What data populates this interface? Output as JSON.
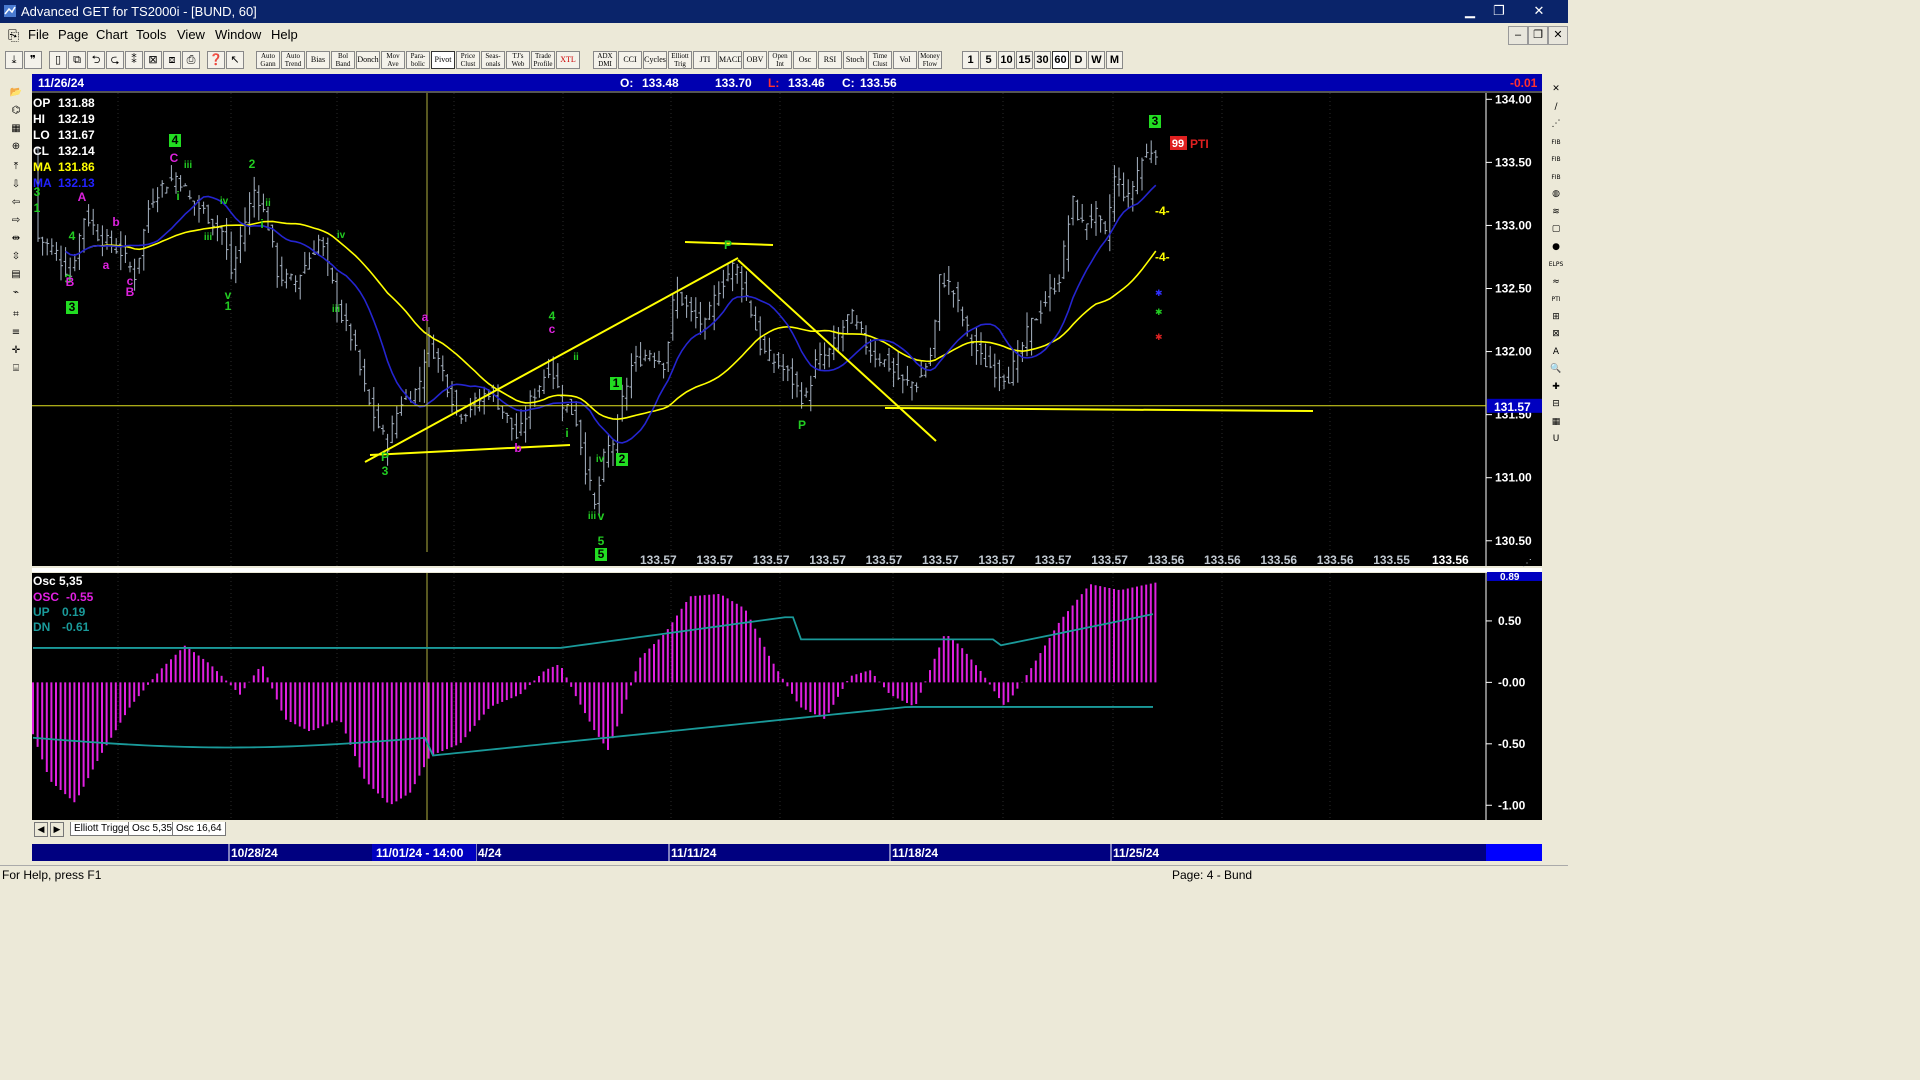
{
  "window": {
    "title": "Advanced GET for TS2000i - [BUND, 60]",
    "min": "▁",
    "restore": "❐",
    "close": "✕"
  },
  "menu": [
    "File",
    "Page",
    "Chart",
    "Tools",
    "View",
    "Window",
    "Help"
  ],
  "mdi_buttons": [
    "‒",
    "❐",
    "✕"
  ],
  "toolbar_icons": [
    "⤓",
    "❞",
    "▯",
    "⧉",
    "⮌",
    "⮎",
    "⁑",
    "⊠",
    "⧈",
    "⎙",
    "❓",
    "↖"
  ],
  "toolbar_studies": [
    [
      "Auto",
      "Gann"
    ],
    [
      "Auto",
      "Trend"
    ],
    [
      "Bias",
      ""
    ],
    [
      "Bol",
      "Band"
    ],
    [
      "Donch",
      ""
    ],
    [
      "Mov",
      "Ave"
    ],
    [
      "Para-",
      "bolic"
    ],
    [
      "Pivot",
      ""
    ],
    [
      "Price",
      "Clust"
    ],
    [
      "Seas-",
      "onals"
    ],
    [
      "TJ's",
      "Web"
    ],
    [
      "Trade",
      "Profile"
    ],
    [
      "XTL",
      ""
    ],
    [
      "ADX",
      "DMI"
    ],
    [
      "CCI",
      ""
    ],
    [
      "Cycles",
      ""
    ],
    [
      "Elliott",
      "Trig"
    ],
    [
      "JTI",
      ""
    ],
    [
      "MACD",
      ""
    ],
    [
      "OBV",
      ""
    ],
    [
      "Open",
      "Int"
    ],
    [
      "Osc",
      ""
    ],
    [
      "RSI",
      ""
    ],
    [
      "Stoch",
      ""
    ],
    [
      "Time",
      "Clust"
    ],
    [
      "Vol",
      ""
    ],
    [
      "Money",
      "Flow"
    ]
  ],
  "intervals": [
    "1",
    "5",
    "10",
    "15",
    "30",
    "60",
    "D",
    "W",
    "M"
  ],
  "left_tools": [
    "📂",
    "⌬",
    "▦",
    "⊕",
    "⤒",
    "⇩",
    "⇦",
    "⇨",
    "⇹",
    "⇳",
    "▤",
    "⌁",
    "⌗",
    "≡",
    "✛",
    "⌸"
  ],
  "right_tools": [
    "✕",
    "∕",
    "⋰",
    "FIB",
    "FIB",
    "FIB",
    "◍",
    "≋",
    "▢",
    "●",
    "ELPS",
    "≈",
    "PTI",
    "⊞",
    "⊠",
    "A",
    "🔍",
    "✚",
    "⊟",
    "▦",
    "U"
  ],
  "chart": {
    "header": {
      "date": "11/26/24",
      "o_label": "O:",
      "o_value": "133.48",
      "h_value": "133.70",
      "l_label": "L:",
      "l_value": "133.46",
      "c_label": "C:",
      "c_value": "133.56",
      "change": "-0.01"
    },
    "readout": [
      {
        "label": "OP",
        "value": "131.88",
        "color": "#FFFFFF"
      },
      {
        "label": "HI",
        "value": "132.19",
        "color": "#FFFFFF"
      },
      {
        "label": "LO",
        "value": "131.67",
        "color": "#FFFFFF"
      },
      {
        "label": "CL",
        "value": "132.14",
        "color": "#FFFFFF"
      },
      {
        "label": "MA",
        "value": "131.86",
        "color": "#FFFF00"
      },
      {
        "label": "MA",
        "value": "132.13",
        "color": "#2222FF"
      }
    ],
    "price_ticks": [
      "134.00",
      "133.50",
      "133.00",
      "132.50",
      "132.00",
      "131.50",
      "131.00",
      "130.50"
    ],
    "price_axis": [
      130.3,
      134.05
    ],
    "hline_value": 131.57,
    "hline_label": "131.57",
    "projection_values": [
      "133.57",
      "133.57",
      "133.57",
      "133.57",
      "133.57",
      "133.57",
      "133.57",
      "133.57",
      "133.57",
      "133.56",
      "133.56",
      "133.56",
      "133.56",
      "133.55"
    ],
    "projection_last": "133.56",
    "pti_value": "99",
    "pti_label": "PTI",
    "dash_labels": [
      "-4-",
      "-4-"
    ],
    "wave_labels": [
      {
        "t": "3",
        "c": "#22CC22",
        "box": false
      },
      {
        "t": "1",
        "c": "#22CC22",
        "box": false
      },
      {
        "t": "A",
        "c": "#DD22DD",
        "box": false
      },
      {
        "t": "4",
        "c": "#22CC22",
        "box": false
      },
      {
        "t": "b",
        "c": "#DD22DD",
        "box": false
      },
      {
        "t": "a",
        "c": "#DD22DD",
        "box": false
      },
      {
        "t": "3",
        "c": "#22CC22",
        "box": false
      },
      {
        "t": "B",
        "c": "#DD22DD",
        "box": false
      },
      {
        "t": "c",
        "c": "#DD22DD",
        "box": false
      },
      {
        "t": "B",
        "c": "#DD22DD",
        "box": false
      },
      {
        "t": "3",
        "c": "#000000",
        "box": true
      },
      {
        "t": "4",
        "c": "#000000",
        "box": true
      },
      {
        "t": "C",
        "c": "#DD22DD",
        "box": false
      },
      {
        "t": "iii",
        "c": "#22CC22",
        "box": false
      },
      {
        "t": "i",
        "c": "#22CC22",
        "box": false
      },
      {
        "t": "iv",
        "c": "#22CC22",
        "box": false
      },
      {
        "t": "iii",
        "c": "#22CC22",
        "box": false
      },
      {
        "t": "2",
        "c": "#22CC22",
        "box": false
      },
      {
        "t": "ii",
        "c": "#22CC22",
        "box": false
      },
      {
        "t": "i",
        "c": "#22CC22",
        "box": false
      },
      {
        "t": "v",
        "c": "#22CC22",
        "box": false
      },
      {
        "t": "1",
        "c": "#22CC22",
        "box": false
      },
      {
        "t": "iv",
        "c": "#22CC22",
        "box": false
      },
      {
        "t": "iii",
        "c": "#22CC22",
        "box": false
      },
      {
        "t": "a",
        "c": "#DD22DD",
        "box": false
      },
      {
        "t": "P",
        "c": "#22CC22",
        "box": false
      },
      {
        "t": "3",
        "c": "#22CC22",
        "box": false
      },
      {
        "t": "b",
        "c": "#DD22DD",
        "box": false
      },
      {
        "t": "4",
        "c": "#22CC22",
        "box": false
      },
      {
        "t": "c",
        "c": "#DD22DD",
        "box": false
      },
      {
        "t": "ii",
        "c": "#22CC22",
        "box": false
      },
      {
        "t": "i",
        "c": "#22CC22",
        "box": false
      },
      {
        "t": "1",
        "c": "#000000",
        "box": true
      },
      {
        "t": "iv",
        "c": "#22CC22",
        "box": false
      },
      {
        "t": "2",
        "c": "#000000",
        "box": true
      },
      {
        "t": "iii",
        "c": "#22CC22",
        "box": false
      },
      {
        "t": "v",
        "c": "#22CC22",
        "box": false
      },
      {
        "t": "5",
        "c": "#22CC22",
        "box": false
      },
      {
        "t": "5",
        "c": "#000000",
        "box": true
      },
      {
        "t": "P",
        "c": "#22CC22",
        "box": false
      },
      {
        "t": "P",
        "c": "#22CC22",
        "box": false
      },
      {
        "t": "3",
        "c": "#000000",
        "box": true
      }
    ]
  },
  "osc": {
    "title": "Osc 5,35",
    "osc_label": "OSC",
    "osc_value": "-0.55",
    "up_label": "UP",
    "up_value": "0.19",
    "dn_label": "DN",
    "dn_value": "-0.61",
    "ticks": [
      "0.50",
      "-0.00",
      "-0.50",
      "-1.00"
    ],
    "top_value": "0.89",
    "axis": [
      -1.12,
      0.89
    ]
  },
  "tabs": [
    "Elliott Trigger",
    "Osc 5,35",
    "Osc 16,64"
  ],
  "date_axis": [
    "10/28/24",
    "4/24",
    "11/11/24",
    "11/18/24",
    "11/25/24"
  ],
  "date_axis_highlight": "11/01/24 - 14:00",
  "status": {
    "help": "For Help, press F1",
    "page": "Page: 4 - Bund"
  },
  "colors": {
    "bg": "#000000",
    "grid": "#3A3A3A",
    "bars": "#A8B4C4",
    "ma_fast": "#FFFF00",
    "ma_slow": "#2525D0",
    "osc": "#E020E0",
    "bands": "#1A9A9A",
    "trend": "#FFFF00"
  }
}
